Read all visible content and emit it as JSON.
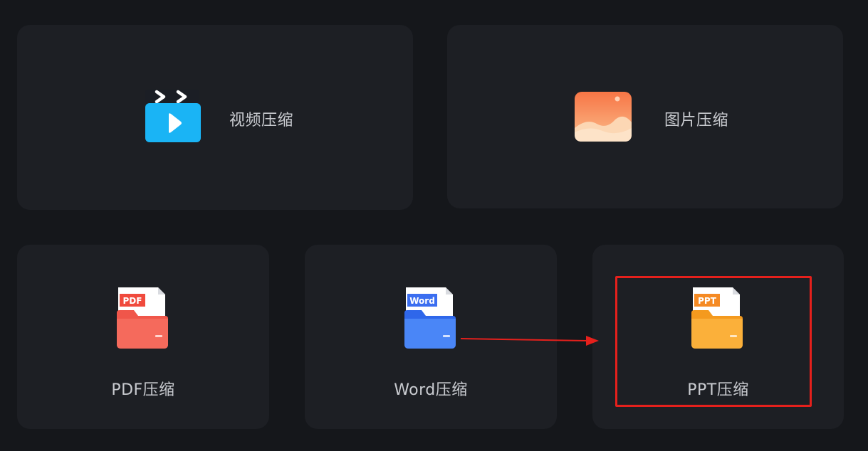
{
  "cards": {
    "video": {
      "label": "视频压缩",
      "icon": "video-clapper-icon"
    },
    "image": {
      "label": "图片压缩",
      "icon": "image-landscape-icon"
    },
    "pdf": {
      "label": "PDF压缩",
      "icon": "pdf-folder-icon",
      "badge": "PDF"
    },
    "word": {
      "label": "Word压缩",
      "icon": "word-folder-icon",
      "badge": "Word"
    },
    "ppt": {
      "label": "PPT压缩",
      "icon": "ppt-folder-icon",
      "badge": "PPT"
    }
  },
  "annotation": {
    "highlight_color": "#e5201c",
    "target": "ppt"
  },
  "colors": {
    "background": "#15171b",
    "card": "#1d1f24",
    "text": "#c9cbd0",
    "video_blue": "#1ab4f5",
    "image_orange": "#f9834a",
    "pdf_red": "#f05a4f",
    "word_blue": "#3f7cf6",
    "ppt_orange": "#f9a52c"
  }
}
